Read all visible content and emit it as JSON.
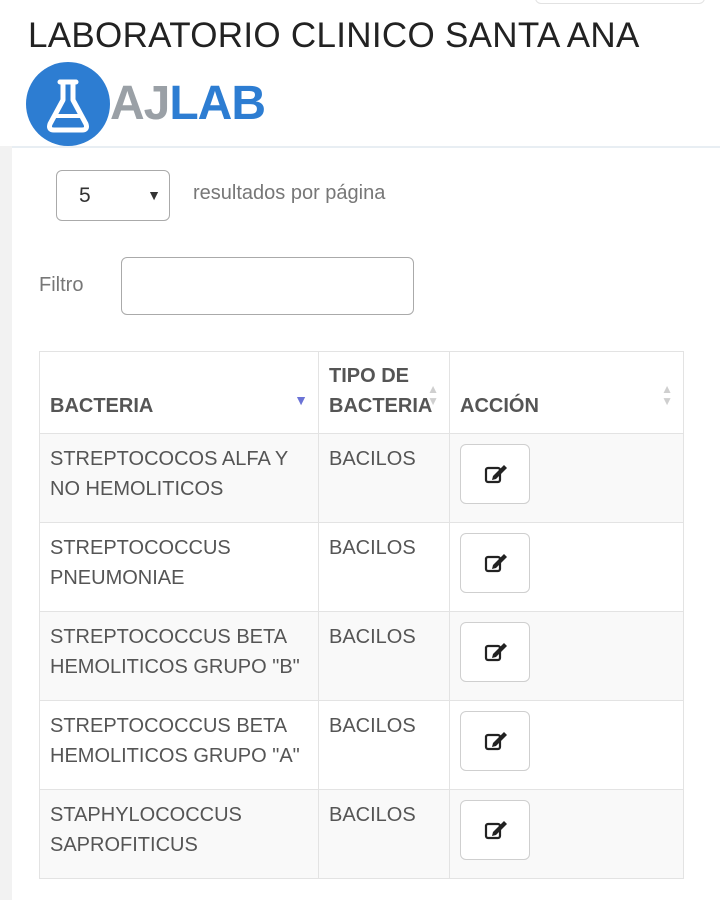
{
  "header": {
    "lab_name": "LABORATORIO CLINICO SANTA ANA",
    "logo": {
      "text_aj": "AJ",
      "text_lab": "LAB",
      "icon": "flask-icon"
    }
  },
  "pagination": {
    "page_size": "5",
    "page_size_suffix": "resultados por página"
  },
  "filter": {
    "label": "Filtro",
    "value": "",
    "placeholder": ""
  },
  "table": {
    "columns": [
      {
        "label": "BACTERIA",
        "sort": "descending"
      },
      {
        "label": "TIPO DE BACTERIA",
        "sort": "none"
      },
      {
        "label": "ACCIÓN",
        "sort": "none"
      }
    ],
    "rows": [
      {
        "bacteria": "STREPTOCOCOS ALFA Y NO HEMOLITICOS",
        "tipo": "BACILOS",
        "action_icon": "edit-icon"
      },
      {
        "bacteria": "STREPTOCOCCUS PNEUMONIAE",
        "tipo": "BACILOS",
        "action_icon": "edit-icon"
      },
      {
        "bacteria": "STREPTOCOCCUS BETA HEMOLITICOS GRUPO \"B\"",
        "tipo": "BACILOS",
        "action_icon": "edit-icon"
      },
      {
        "bacteria": "STREPTOCOCCUS BETA HEMOLITICOS GRUPO \"A\"",
        "tipo": "BACILOS",
        "action_icon": "edit-icon"
      },
      {
        "bacteria": "STAPHYLOCOCCUS SAPROFITICUS",
        "tipo": "BACILOS",
        "action_icon": "edit-icon"
      }
    ]
  },
  "colors": {
    "brand_blue": "#2d7dd2",
    "sort_active": "#6b73d6"
  }
}
